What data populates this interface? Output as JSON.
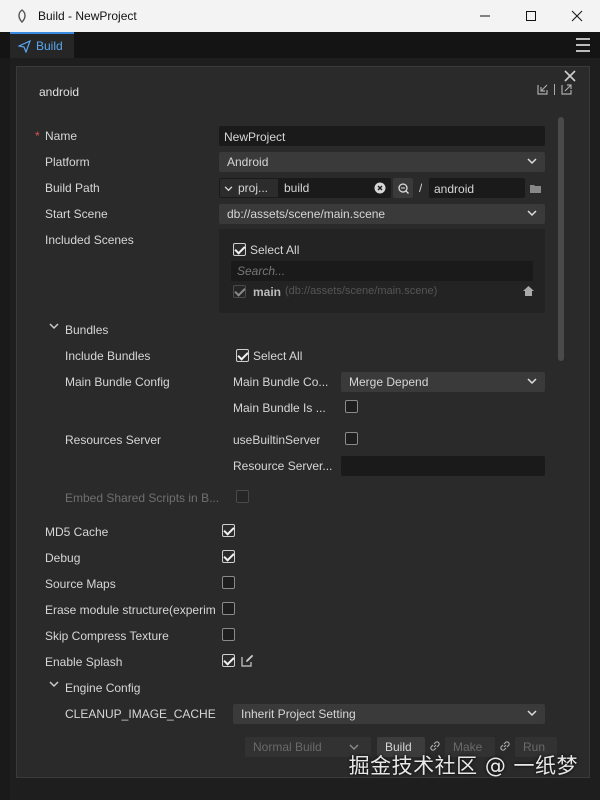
{
  "window": {
    "title": "Build - NewProject"
  },
  "tab": {
    "label": "Build"
  },
  "panel": {
    "platform_name": "android"
  },
  "fields": {
    "name_label": "Name",
    "name_value": "NewProject",
    "platform_label": "Platform",
    "platform_value": "Android",
    "build_path_label": "Build Path",
    "build_path_prefix": "proj...",
    "build_path_dir": "build",
    "build_path_sep": "/",
    "build_path_target": "android",
    "start_scene_label": "Start Scene",
    "start_scene_value": "db://assets/scene/main.scene",
    "included_scenes_label": "Included Scenes",
    "select_all_label": "Select All",
    "search_placeholder": "Search...",
    "scene_name": "main",
    "scene_path": "(db://assets/scene/main.scene)"
  },
  "bundles": {
    "section_label": "Bundles",
    "include_bundles_label": "Include Bundles",
    "include_bundles_option": "Select All",
    "main_bundle_config_label": "Main Bundle Config",
    "main_bundle_compression_label": "Main Bundle Co...",
    "main_bundle_compression_value": "Merge Depend",
    "main_bundle_is_remote_label": "Main Bundle Is ...",
    "resources_server_label": "Resources Server",
    "use_builtin_server_label": "useBuiltinServer",
    "resource_server_addr_label": "Resource Server...",
    "embed_shared_scripts_label": "Embed Shared Scripts in B..."
  },
  "options": {
    "md5_cache_label": "MD5 Cache",
    "debug_label": "Debug",
    "source_maps_label": "Source Maps",
    "erase_module_label": "Erase module structure(experim",
    "skip_compress_label": "Skip Compress Texture",
    "enable_splash_label": "Enable Splash"
  },
  "engine": {
    "section_label": "Engine Config",
    "cleanup_image_cache_label": "CLEANUP_IMAGE_CACHE",
    "cleanup_image_cache_value": "Inherit Project Setting"
  },
  "footer": {
    "build_mode": "Normal Build",
    "build_button": "Build",
    "make_button": "Make",
    "run_button": "Run"
  },
  "watermark": "掘金技术社区 @ 一纸梦",
  "colors": {
    "accent": "#3a8be0",
    "panel_bg": "#2a2a2a",
    "input_bg": "#1a1a1a"
  }
}
